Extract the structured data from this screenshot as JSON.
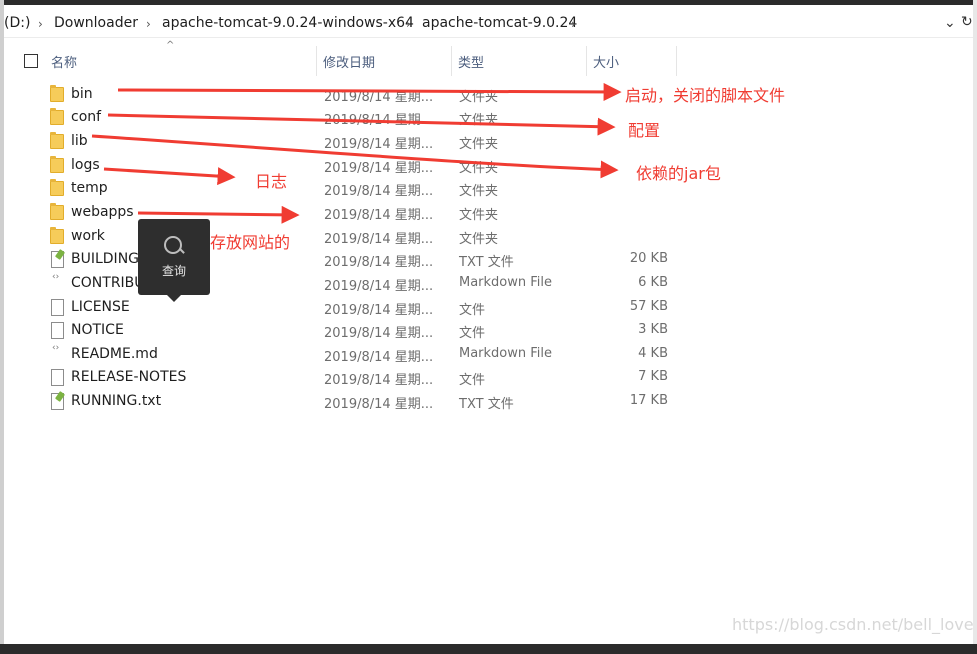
{
  "breadcrumb": {
    "drive": "(D:)",
    "items": [
      "Downloader",
      "apache-tomcat-9.0.24-windows-x64",
      "apache-tomcat-9.0.24"
    ],
    "separator": "›"
  },
  "columns": {
    "name": "名称",
    "date": "修改日期",
    "type": "类型",
    "size": "大小"
  },
  "files": [
    {
      "name": "bin",
      "date": "2019/8/14 星期...",
      "type": "文件夹",
      "size": "",
      "icon": "folder-icon"
    },
    {
      "name": "conf",
      "date": "2019/8/14 星期...",
      "type": "文件夹",
      "size": "",
      "icon": "folder-icon"
    },
    {
      "name": "lib",
      "date": "2019/8/14 星期...",
      "type": "文件夹",
      "size": "",
      "icon": "folder-icon"
    },
    {
      "name": "logs",
      "date": "2019/8/14 星期...",
      "type": "文件夹",
      "size": "",
      "icon": "folder-icon"
    },
    {
      "name": "temp",
      "date": "2019/8/14 星期...",
      "type": "文件夹",
      "size": "",
      "icon": "folder-icon"
    },
    {
      "name": "webapps",
      "date": "2019/8/14 星期...",
      "type": "文件夹",
      "size": "",
      "icon": "folder-icon"
    },
    {
      "name": "work",
      "date": "2019/8/14 星期...",
      "type": "文件夹",
      "size": "",
      "icon": "folder-icon"
    },
    {
      "name": "BUILDING",
      "date": "2019/8/14 星期...",
      "type": "TXT 文件",
      "size": "20 KB",
      "icon": "text-file-icon"
    },
    {
      "name": "CONTRIBU",
      "date": "2019/8/14 星期...",
      "type": "Markdown File",
      "size": "6 KB",
      "icon": "markdown-file-icon"
    },
    {
      "name": "LICENSE",
      "date": "2019/8/14 星期...",
      "type": "文件",
      "size": "57 KB",
      "icon": "file-icon"
    },
    {
      "name": "NOTICE",
      "date": "2019/8/14 星期...",
      "type": "文件",
      "size": "3 KB",
      "icon": "file-icon"
    },
    {
      "name": "README.md",
      "date": "2019/8/14 星期...",
      "type": "Markdown File",
      "size": "4 KB",
      "icon": "markdown-file-icon"
    },
    {
      "name": "RELEASE-NOTES",
      "date": "2019/8/14 星期...",
      "type": "文件",
      "size": "7 KB",
      "icon": "file-icon"
    },
    {
      "name": "RUNNING.txt",
      "date": "2019/8/14 星期...",
      "type": "TXT 文件",
      "size": "17 KB",
      "icon": "text-file-icon"
    }
  ],
  "annotations": {
    "bin": "启动，关闭的脚本文件",
    "conf": "配置",
    "lib": "依赖的jar包",
    "logs": "日志",
    "webapps": "发存放网站的",
    "color": "#f03c32"
  },
  "search_popup": {
    "label": "查询",
    "icon": "search-icon"
  },
  "watermark": "https://blog.csdn.net/bell_love"
}
